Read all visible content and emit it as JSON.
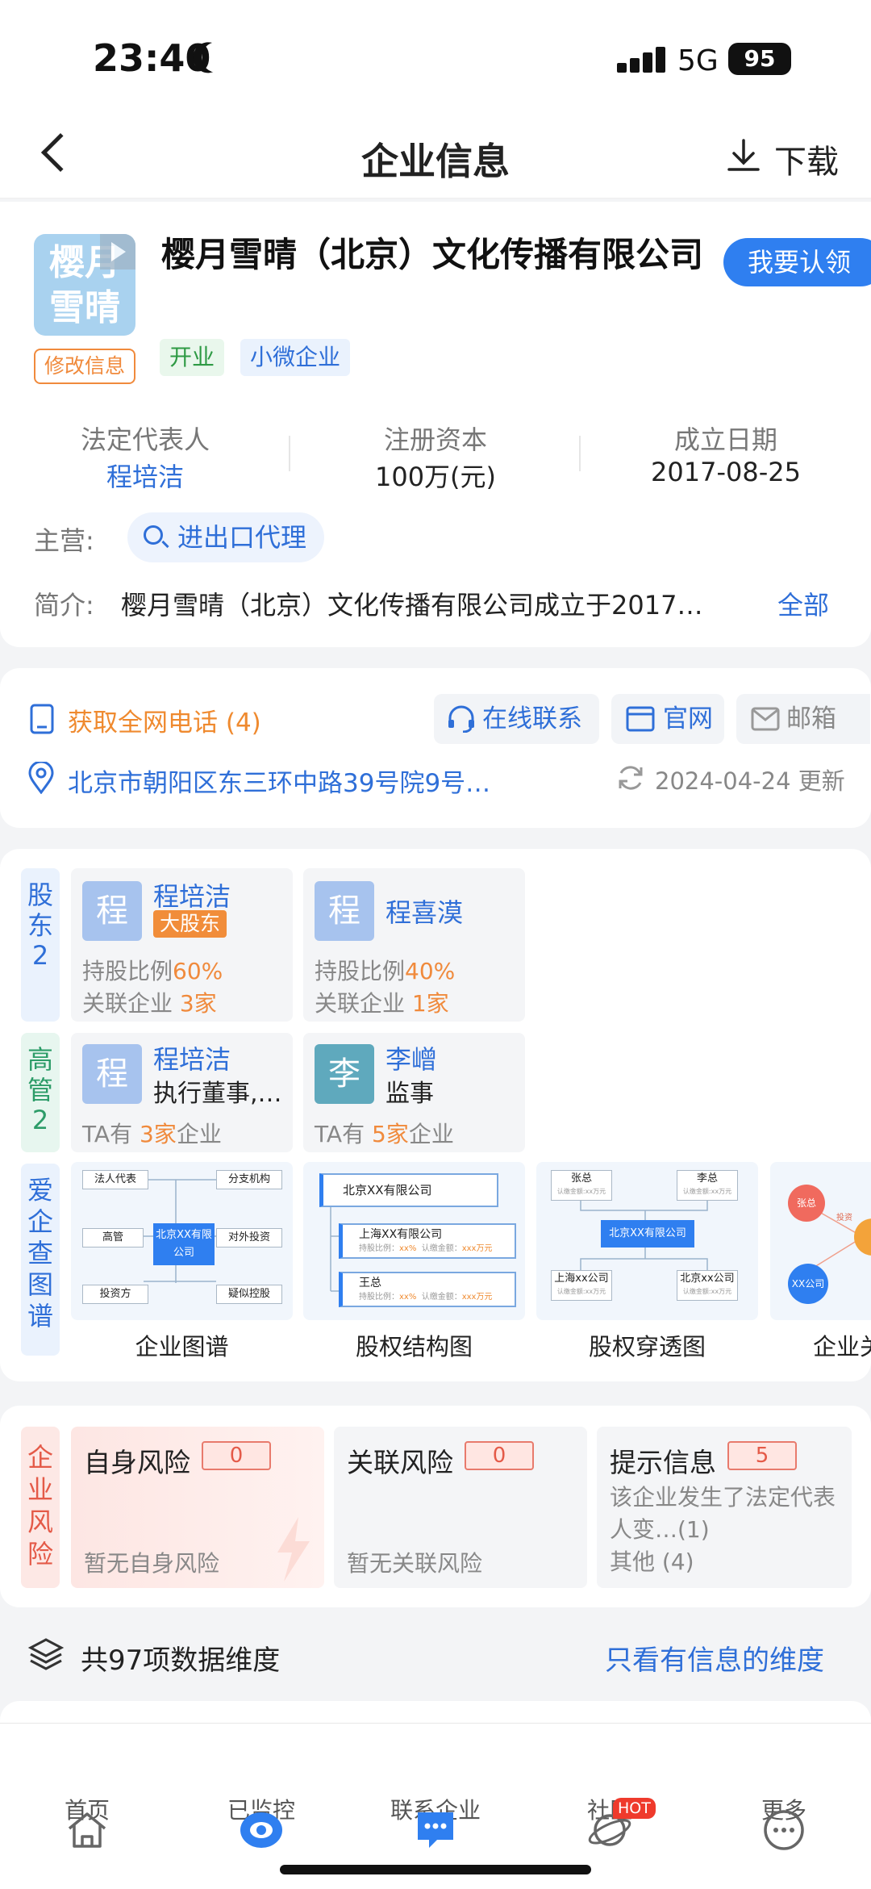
{
  "status_bar": {
    "time": "23:40",
    "network": "5G",
    "battery": "95"
  },
  "header": {
    "title": "企业信息",
    "download_label": "下载"
  },
  "company": {
    "logo_text": "樱月雪晴",
    "edit_label": "修改信息",
    "name": "樱月雪晴（北京）文化传播有限公司",
    "claim_label": "我要认领",
    "tags": [
      "开业",
      "小微企业"
    ],
    "legal_rep": {
      "label": "法定代表人",
      "value": "程培洁"
    },
    "capital": {
      "label": "注册资本",
      "value": "100万(元)"
    },
    "founded": {
      "label": "成立日期",
      "value": "2017-08-25"
    },
    "main_business": {
      "label": "主营:",
      "value": "进出口代理"
    },
    "intro": {
      "label": "简介:",
      "value": "樱月雪晴（北京）文化传播有限公司成立于2017…",
      "more": "全部"
    }
  },
  "contact": {
    "phone_label": "获取全网电话 (4)",
    "online_label": "在线联系",
    "website_label": "官网",
    "email_label": "邮箱",
    "address": "北京市朝阳区东三环中路39号院9号…",
    "updated": "2024-04-24 更新"
  },
  "shareholders": {
    "section_label": "股东",
    "count": "2",
    "items": [
      {
        "avatar": "程",
        "name": "程培洁",
        "badge": "大股东",
        "ratio_label": "持股比例",
        "ratio": "60%",
        "related_label": "关联企业",
        "related": "3家"
      },
      {
        "avatar": "程",
        "name": "程喜漠",
        "ratio_label": "持股比例",
        "ratio": "40%",
        "related_label": "关联企业",
        "related": "1家"
      }
    ]
  },
  "executives": {
    "section_label": "高管",
    "count": "2",
    "items": [
      {
        "avatar": "程",
        "name": "程培洁",
        "role": "执行董事,…",
        "pre": "TA有",
        "num": "3家",
        "post": "企业"
      },
      {
        "avatar": "李",
        "name": "李嶒",
        "role": "监事",
        "pre": "TA有",
        "num": "5家",
        "post": "企业"
      }
    ]
  },
  "graphs": {
    "section_label": "爱企查图谱",
    "items": [
      "企业图谱",
      "股权结构图",
      "股权穿透图",
      "企业关"
    ],
    "thumb1": {
      "center": "北京XX有限公司",
      "nodes": [
        "法人代表",
        "分支机构",
        "高管",
        "对外投资",
        "投资方",
        "疑似控股"
      ]
    },
    "thumb2": {
      "top": "北京XX有限公司",
      "child1": "上海XX有限公司",
      "child2": "王总",
      "ratio_label": "持股比例：",
      "ratio": "xx%",
      "amount_label": "认缴金额：",
      "amount": "xxx万元"
    },
    "thumb3": {
      "a": "张总",
      "b": "李总",
      "center": "北京XX有限公司",
      "c": "上海xx公司",
      "d": "北京xx公司",
      "sub": "认缴金额:xx万元"
    },
    "thumb4": {
      "a": "张总",
      "b": "XX公司",
      "c": "投资"
    }
  },
  "risk": {
    "section_label": "企业风险",
    "self": {
      "title": "自身风险",
      "count": "0",
      "desc": "暂无自身风险"
    },
    "related": {
      "title": "关联风险",
      "count": "0",
      "desc": "暂无关联风险"
    },
    "hint": {
      "title": "提示信息",
      "count": "5",
      "line1": "该企业发生了法定代表",
      "line2": "人变…(1)",
      "line3": "其他 (4)"
    }
  },
  "dimensions": {
    "summary": "共97项数据维度",
    "filter_label": "只看有信息的维度"
  },
  "nav": {
    "items": [
      "首页",
      "已监控",
      "联系企业",
      "社区",
      "更多"
    ],
    "hot_badge": "HOT"
  }
}
